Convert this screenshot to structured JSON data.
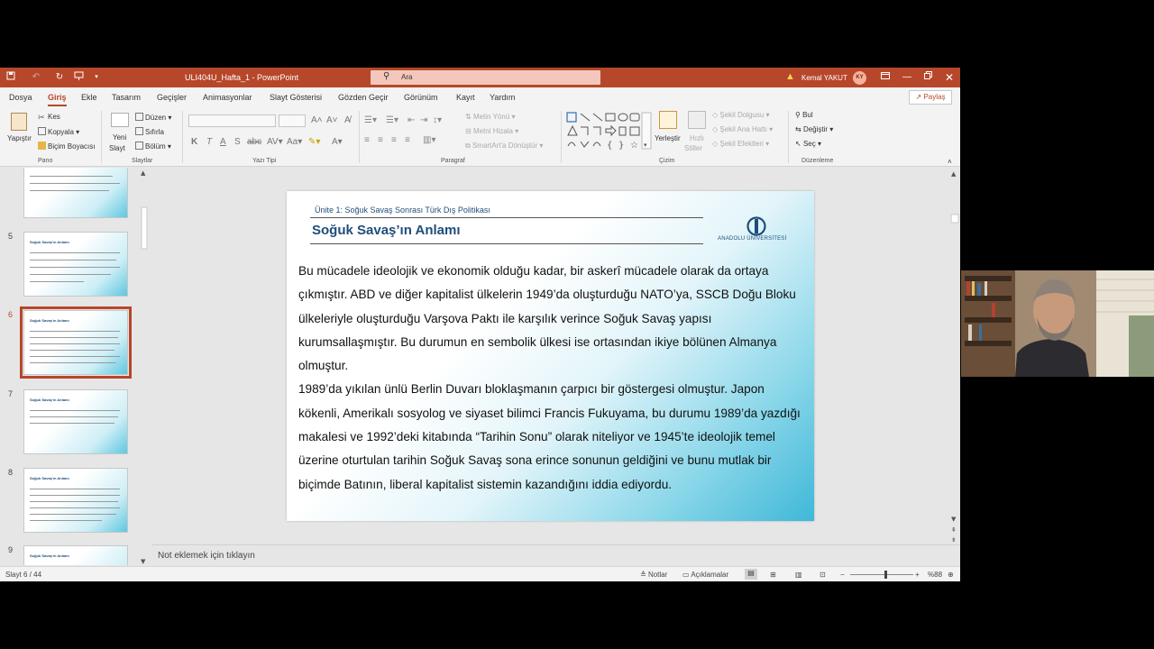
{
  "window": {
    "doc_title": "ULI404U_Hafta_1  -  PowerPoint",
    "search_placeholder": "Ara",
    "user_name": "Kemal YAKUT",
    "user_initials": "KY"
  },
  "tabs": [
    "Dosya",
    "Giriş",
    "Ekle",
    "Tasarım",
    "Geçişler",
    "Animasyonlar",
    "Slayt Gösterisi",
    "Gözden Geçir",
    "Görünüm",
    "Kayıt",
    "Yardım"
  ],
  "share_label": "Paylaş",
  "ribbon": {
    "pano": {
      "label": "Pano",
      "paste": "Yapıştır",
      "cut": "Kes",
      "copy": "Kopyala",
      "format_painter": "Biçim Boyacısı"
    },
    "slides": {
      "label": "Slaytlar",
      "new_slide_1": "Yeni",
      "new_slide_2": "Slayt",
      "layout": "Düzen",
      "reset": "Sıfırla",
      "section": "Bölüm"
    },
    "font": {
      "label": "Yazı Tipi"
    },
    "paragraph": {
      "label": "Paragraf",
      "text_direction": "Metin Yönü",
      "align_text": "Metni Hizala",
      "smartart": "SmartArt'a Dönüştür"
    },
    "drawing": {
      "label": "Çizim",
      "arrange": "Yerleştir",
      "quick_styles_1": "Hızlı",
      "quick_styles_2": "Stiller",
      "shape_fill": "Şekil Dolgusu",
      "shape_outline": "Şekil Ana Hattı",
      "shape_effects": "Şekil Efektleri"
    },
    "editing": {
      "label": "Düzenleme",
      "find": "Bul",
      "replace": "Değiştir",
      "select": "Seç"
    }
  },
  "thumbnails": {
    "n5": "5",
    "n6": "6",
    "n7": "7",
    "n8": "8",
    "n9": "9",
    "title": "Soğuk Savaş'ın Anlamı"
  },
  "slide": {
    "unit": "Ünite 1: Soğuk Savaş Sonrası Türk Dış Politikası",
    "title": "Soğuk Savaş’ın Anlamı",
    "logo_text": "ANADOLU ÜNİVERSİTESİ",
    "paragraph1": "Bu mücadele ideolojik ve ekonomik olduğu kadar, bir askerî mücadele olarak da ortaya çıkmıştır. ABD ve diğer kapitalist ülkelerin 1949’da oluşturduğu NATO’ya, SSCB Doğu Bloku ülkeleriyle oluşturduğu Varşova Paktı ile karşılık verince Soğuk Savaş yapısı kurumsallaşmıştır. Bu durumun en sembolik ülkesi ise ortasından ikiye bölünen Almanya olmuştur.",
    "paragraph2": "1989’da yıkılan ünlü Berlin Duvarı bloklaşmanın çarpıcı bir göstergesi olmuştur. Japon kökenli, Amerikalı sosyolog ve siyaset bilimci Francis Fukuyama, bu durumu 1989’da yazdığı makalesi ve 1992’deki kitabında “Tarihin Sonu” olarak niteliyor ve 1945’te ideolojik temel üzerine oturtulan tarihin Soğuk Savaş sona erince sonunun geldiğini ve bunu mutlak bir biçimde Batının, liberal kapitalist sistemin kazandığını iddia ediyordu."
  },
  "notes_placeholder": "Not eklemek için tıklayın",
  "status": {
    "slide_counter": "Slayt 6 / 44",
    "notes": "Notlar",
    "comments": "Açıklamalar",
    "zoom": "%88",
    "zoom_level": 0.55
  },
  "colors": {
    "accent": "#b7472a",
    "slide_title": "#1f4e79",
    "slide_cyan": "#3fb8d8"
  }
}
